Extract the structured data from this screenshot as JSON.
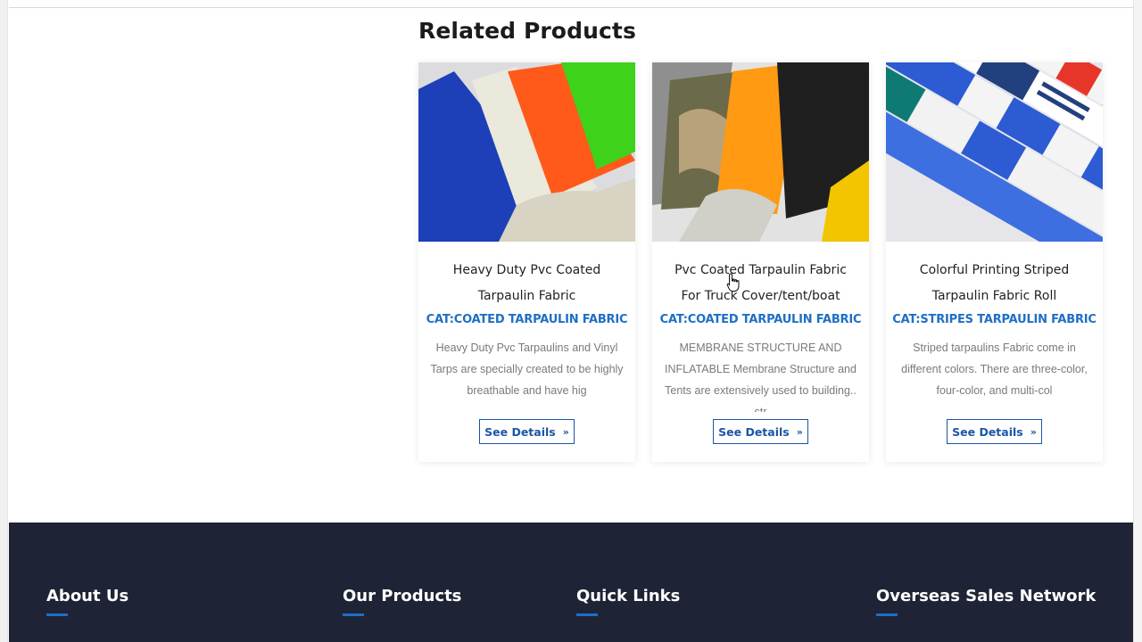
{
  "related": {
    "title": "Related Products",
    "products": [
      {
        "title_line1": "Heavy Duty Pvc Coated",
        "title_line2": "Tarpaulin Fabric",
        "category": "CAT:COATED TARPAULIN FABRIC",
        "description": "Heavy Duty Pvc Tarpaulins and Vinyl Tarps are specially created to be highly breathable and have hig",
        "button": "See Details"
      },
      {
        "title_line1": "Pvc Coated Tarpaulin Fabric",
        "title_line2": "For Truck Cover/tent/boat",
        "category": "CAT:COATED TARPAULIN FABRIC",
        "description": "MEMBRANE STRUCTURE AND INFLATABLE Membrane Structure and Tents are extensively used to building.. str",
        "button": "See Details"
      },
      {
        "title_line1": "Colorful Printing Striped",
        "title_line2": "Tarpaulin Fabric Roll",
        "category": "CAT:STRIPES TARPAULIN FABRIC",
        "description": "Striped tarpaulins Fabric come in different colors. There are three-color, four-color, and multi-col",
        "button": "See Details"
      }
    ]
  },
  "footer": {
    "about": "About Us",
    "products": "Our Products",
    "links": "Quick Links",
    "network": "Overseas Sales Network"
  },
  "colors": {
    "accent": "#1f6fc4",
    "button": "#1a56a6",
    "footer_bg": "#1e2435"
  },
  "icons": {
    "button_chevron": "chevron-double-right-icon",
    "cursor": "hand-pointer-icon"
  }
}
